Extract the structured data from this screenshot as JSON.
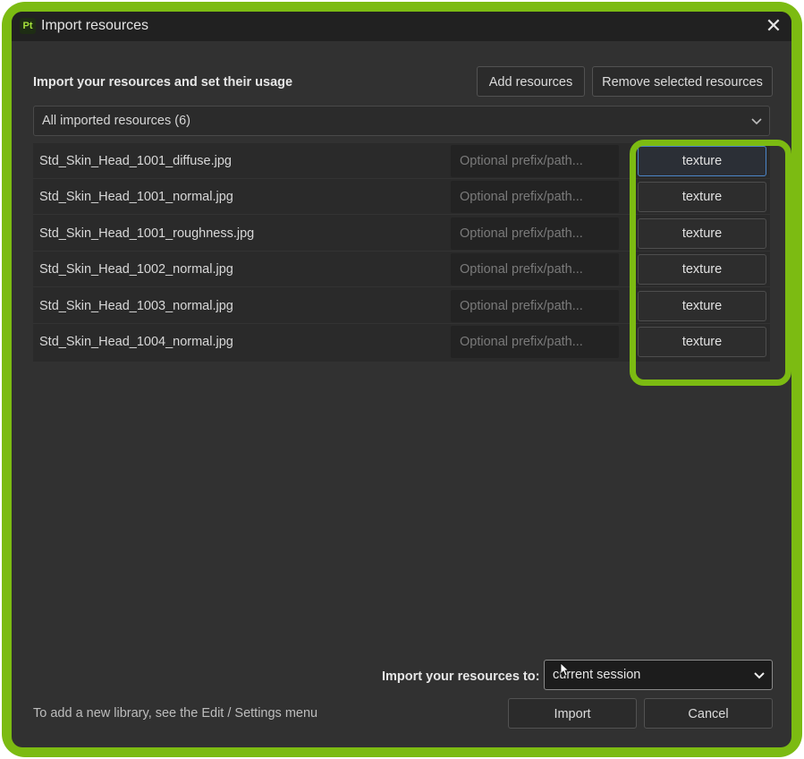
{
  "window": {
    "title": "Import resources",
    "app_icon_text": "Pt",
    "close_icon": "close-icon"
  },
  "header": {
    "heading": "Import your resources and set their usage",
    "add_button": "Add resources",
    "remove_button": "Remove selected resources"
  },
  "filter": {
    "selected": "All imported resources (6)",
    "icon": "chevron-down-icon"
  },
  "resources": [
    {
      "name": "Std_Skin_Head_1001_diffuse.jpg",
      "prefix_placeholder": "Optional prefix/path...",
      "usage": "texture",
      "selected": true
    },
    {
      "name": "Std_Skin_Head_1001_normal.jpg",
      "prefix_placeholder": "Optional prefix/path...",
      "usage": "texture",
      "selected": false
    },
    {
      "name": "Std_Skin_Head_1001_roughness.jpg",
      "prefix_placeholder": "Optional prefix/path...",
      "usage": "texture",
      "selected": false
    },
    {
      "name": "Std_Skin_Head_1002_normal.jpg",
      "prefix_placeholder": "Optional prefix/path...",
      "usage": "texture",
      "selected": false
    },
    {
      "name": "Std_Skin_Head_1003_normal.jpg",
      "prefix_placeholder": "Optional prefix/path...",
      "usage": "texture",
      "selected": false
    },
    {
      "name": "Std_Skin_Head_1004_normal.jpg",
      "prefix_placeholder": "Optional prefix/path...",
      "usage": "texture",
      "selected": false
    }
  ],
  "destination": {
    "label": "Import your resources to:",
    "value": "current session",
    "icon": "chevron-down-icon"
  },
  "footer": {
    "note": "To add a new library, see the Edit / Settings menu",
    "import_button": "Import",
    "cancel_button": "Cancel"
  },
  "colors": {
    "highlight": "#7cbb12",
    "dialog_bg": "#313131",
    "title_bg": "#212121",
    "selected_border": "#4c86c9"
  }
}
